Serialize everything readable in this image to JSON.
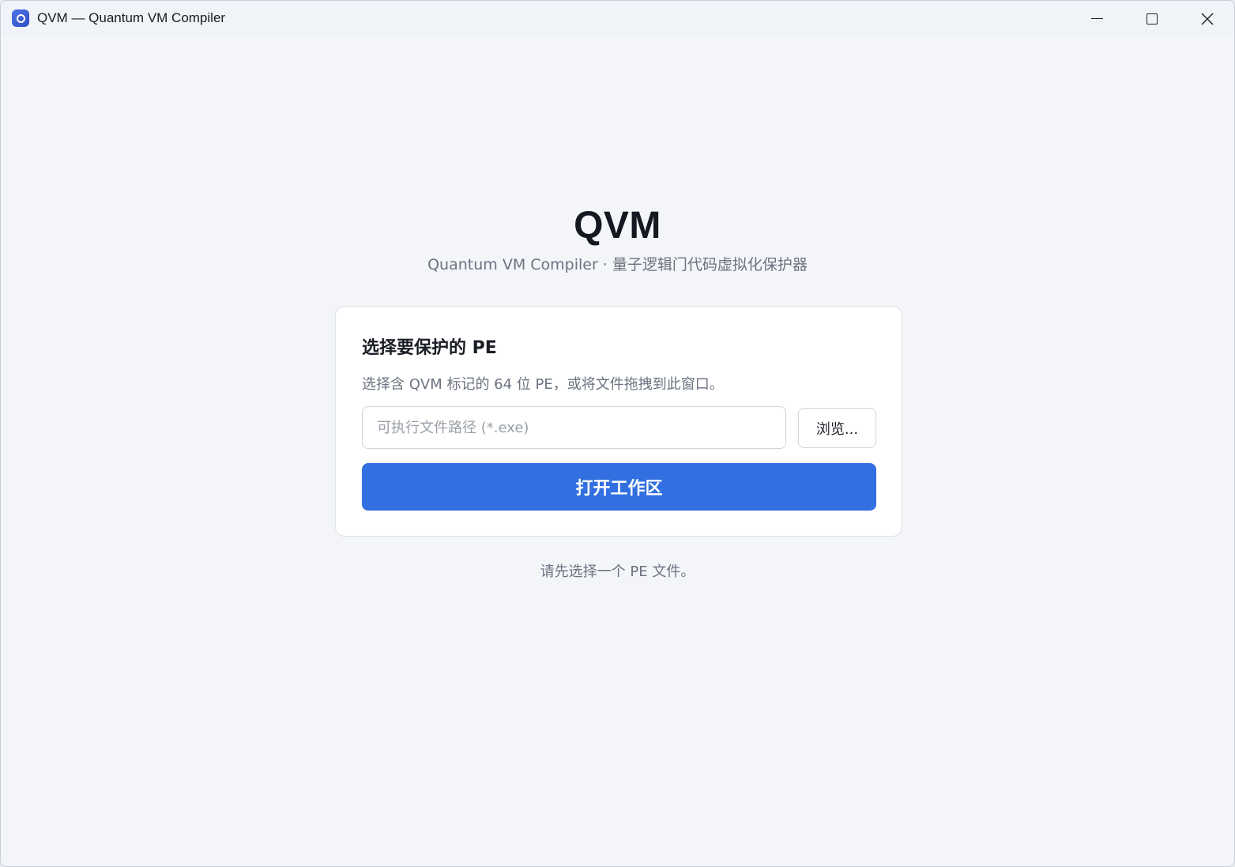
{
  "window": {
    "title": "QVM — Quantum VM Compiler",
    "icon": "app-logo-icon",
    "controls": [
      "minimize-icon",
      "maximize-icon",
      "close-icon"
    ]
  },
  "header": {
    "brand": "QVM",
    "subtitle": "Quantum VM Compiler · 量子逻辑门代码虚拟化保护器"
  },
  "card": {
    "title": "选择要保护的 PE",
    "description": "选择含 QVM 标记的 64 位 PE，或将文件拖拽到此窗口。",
    "path_input": {
      "placeholder": "可执行文件路径 (*.exe)",
      "value": ""
    },
    "browse_label": "浏览...",
    "open_label": "打开工作区"
  },
  "status": "请先选择一个 PE 文件。",
  "colors": {
    "accent": "#326fe0",
    "background": "#f3f5f9",
    "card": "#ffffff",
    "muted_text": "#6b7280"
  }
}
